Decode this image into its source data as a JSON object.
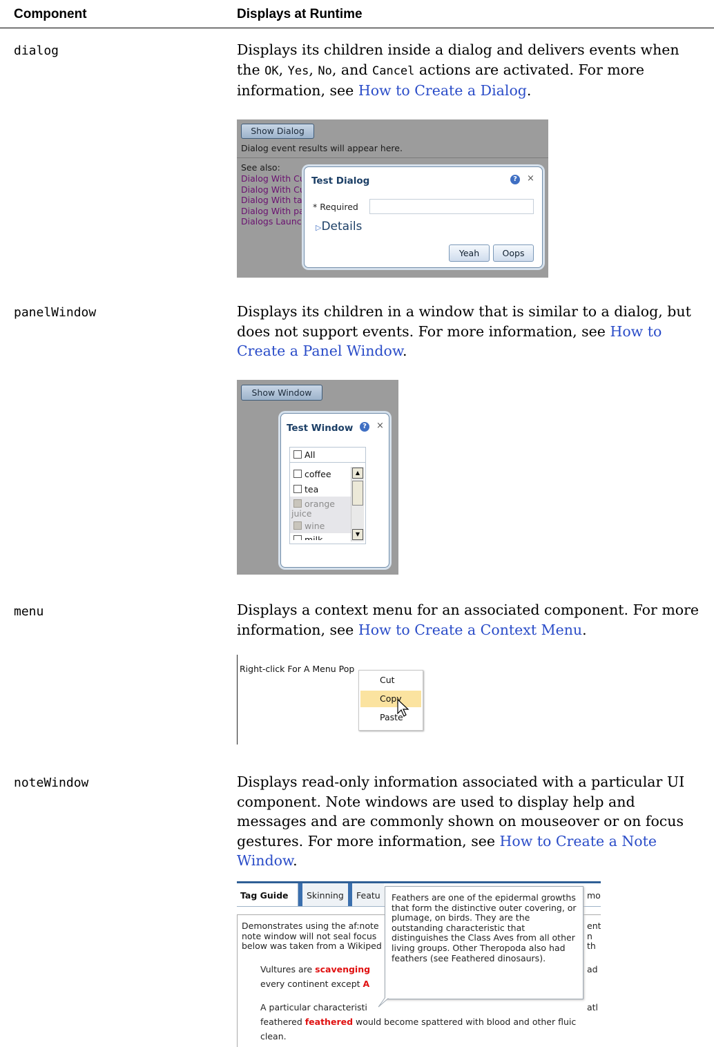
{
  "header": {
    "component": "Component",
    "displays": "Displays at Runtime"
  },
  "rows": {
    "dialog": {
      "name": "dialog",
      "d1": "Displays its children inside a dialog and delivers events when the ",
      "c1": "OK",
      "d2": ", ",
      "c2": "Yes",
      "d3": ", ",
      "c3": "No",
      "d4": ", and ",
      "c4": "Cancel",
      "d5": " actions are activated. For more information, see ",
      "link": "How to Create a Dialog",
      "d6": "."
    },
    "panelWindow": {
      "name": "panelWindow",
      "d1": "Displays its children in a window that is similar to a dialog, but does not support events. For more information, see ",
      "link": "How to Create a Panel Window",
      "d2": "."
    },
    "menu": {
      "name": "menu",
      "d1": "Displays a context menu for an associated component. For more information, see ",
      "link": "How to Create a Context Menu",
      "d2": "."
    },
    "noteWindow": {
      "name": "noteWindow",
      "d1": "Displays read-only information associated with a particular UI component. Note windows are used to display help and messages and are commonly shown on mouseover or on focus gestures. For more information, see ",
      "link": "How to Create a Note Window",
      "d2": "."
    }
  },
  "shot_dialog": {
    "show_button": "Show Dialog",
    "result_text": "Dialog event results will appear here.",
    "see_also": "See also:",
    "links": [
      "Dialog With Cu",
      "Dialog With Cu",
      "Dialog With ta",
      "Dialog With pa",
      "Dialogs Launch"
    ],
    "title": "Test Dialog",
    "required_label": "* Required",
    "details": "Details",
    "yes_button": "Yeah",
    "no_button": "Oops",
    "close": "×",
    "help": "?"
  },
  "shot_window": {
    "show_button": "Show Window",
    "title": "Test Window",
    "close": "×",
    "help": "?",
    "all_label": "All",
    "items": [
      "coffee",
      "tea",
      "orange",
      "juice",
      "wine",
      "milk"
    ]
  },
  "shot_menu": {
    "trigger_text": "Right-click For A Menu Pop",
    "items": [
      "Cut",
      "Copy",
      "Paste"
    ]
  },
  "shot_note": {
    "tabs": [
      "Tag Guide",
      "Skinning",
      "Featu",
      "mor"
    ],
    "body_lines": [
      "Demonstrates using the af:note",
      "note window will not seal focus",
      "below was taken from a Wikiped"
    ],
    "right_frags": [
      "ent",
      "n th",
      "ad",
      "atl"
    ],
    "vultures_pre": "Vultures are ",
    "vultures_word": "scavenging",
    "continent_pre": "every continent except ",
    "continent_word": "A",
    "particular": "A particular characteristi",
    "feathered_pre": "feathered ",
    "feathered_word": "feathered",
    "feathered_post": " would become spattered with blood and other fluic",
    "clean": "clean.",
    "note_text": "Feathers are one of the epidermal growths that form the distinctive outer covering, or plumage, on birds. They are the outstanding characteristic that distinguishes the Class Aves from all other living groups. Other Theropoda also had feathers (see Feathered dinosaurs)."
  }
}
